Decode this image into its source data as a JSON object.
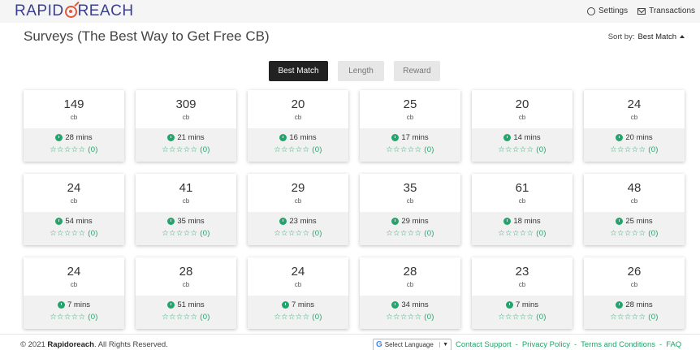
{
  "brand": {
    "left": "RAPID",
    "right": "REACH"
  },
  "topnav": {
    "settings": "Settings",
    "transactions": "Transactions"
  },
  "page": {
    "title": "Surveys (The Best Way to Get Free CB)"
  },
  "sort": {
    "label": "Sort by:",
    "value": "Best Match"
  },
  "tabs": [
    "Best Match",
    "Length",
    "Reward"
  ],
  "surveys": [
    {
      "amount": "149",
      "unit": "cb",
      "time": "28 mins",
      "rating": "☆☆☆☆☆ (0)"
    },
    {
      "amount": "309",
      "unit": "cb",
      "time": "21 mins",
      "rating": "☆☆☆☆☆ (0)"
    },
    {
      "amount": "20",
      "unit": "cb",
      "time": "16 mins",
      "rating": "☆☆☆☆☆ (0)"
    },
    {
      "amount": "25",
      "unit": "cb",
      "time": "17 mins",
      "rating": "☆☆☆☆☆ (0)"
    },
    {
      "amount": "20",
      "unit": "cb",
      "time": "14 mins",
      "rating": "☆☆☆☆☆ (0)"
    },
    {
      "amount": "24",
      "unit": "cb",
      "time": "20 mins",
      "rating": "☆☆☆☆☆ (0)"
    },
    {
      "amount": "24",
      "unit": "cb",
      "time": "54 mins",
      "rating": "☆☆☆☆☆ (0)"
    },
    {
      "amount": "41",
      "unit": "cb",
      "time": "35 mins",
      "rating": "☆☆☆☆☆ (0)"
    },
    {
      "amount": "29",
      "unit": "cb",
      "time": "23 mins",
      "rating": "☆☆☆☆☆ (0)"
    },
    {
      "amount": "35",
      "unit": "cb",
      "time": "29 mins",
      "rating": "☆☆☆☆☆ (0)"
    },
    {
      "amount": "61",
      "unit": "cb",
      "time": "18 mins",
      "rating": "☆☆☆☆☆ (0)"
    },
    {
      "amount": "48",
      "unit": "cb",
      "time": "25 mins",
      "rating": "☆☆☆☆☆ (0)"
    },
    {
      "amount": "24",
      "unit": "cb",
      "time": "7 mins",
      "rating": "☆☆☆☆☆ (0)"
    },
    {
      "amount": "28",
      "unit": "cb",
      "time": "51 mins",
      "rating": "☆☆☆☆☆ (0)"
    },
    {
      "amount": "24",
      "unit": "cb",
      "time": "7 mins",
      "rating": "☆☆☆☆☆ (0)"
    },
    {
      "amount": "28",
      "unit": "cb",
      "time": "34 mins",
      "rating": "☆☆☆☆☆ (0)"
    },
    {
      "amount": "23",
      "unit": "cb",
      "time": "7 mins",
      "rating": "☆☆☆☆☆ (0)"
    },
    {
      "amount": "26",
      "unit": "cb",
      "time": "28 mins",
      "rating": "☆☆☆☆☆ (0)"
    }
  ],
  "footer": {
    "copyright_prefix": "© 2021",
    "copyright_brand": "Rapidoreach",
    "copyright_suffix": ". All Rights Reserved.",
    "language": "Select Language",
    "links": [
      "Contact Support",
      "Privacy Policy",
      "Terms and Conditions",
      "FAQ"
    ]
  },
  "colors": {
    "accent": "#22a56a",
    "brand": "#3b3f8c",
    "brand_o": "#e8533a",
    "active_tab": "#222222"
  }
}
